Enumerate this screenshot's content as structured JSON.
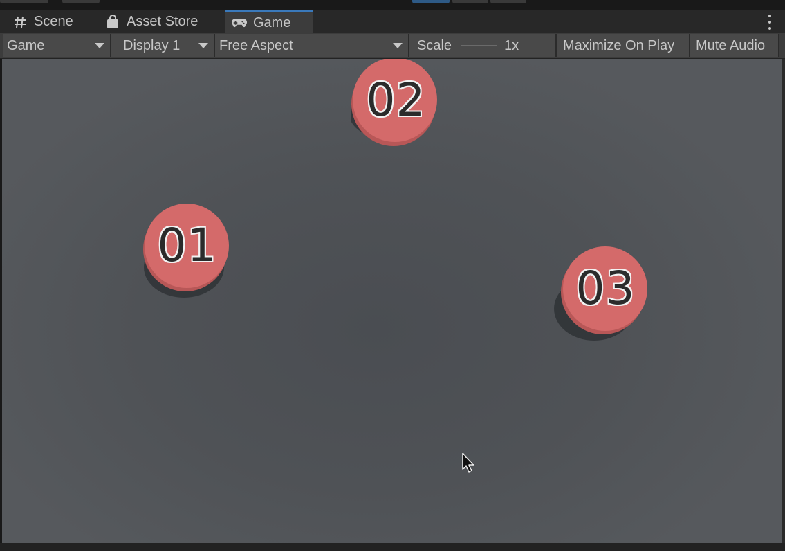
{
  "tabs": [
    {
      "label": "Scene",
      "icon": "grid-icon",
      "active": false
    },
    {
      "label": "Asset Store",
      "icon": "bag-icon",
      "active": false
    },
    {
      "label": "Game",
      "icon": "gamepad-icon",
      "active": true
    }
  ],
  "toolbar": {
    "view_mode": "Game",
    "display": "Display 1",
    "aspect": "Free Aspect",
    "scale_label": "Scale",
    "scale_value": "1x",
    "maximize_label": "Maximize On Play",
    "mute_label": "Mute Audio"
  },
  "game": {
    "tokens": [
      {
        "label": "01",
        "color": "#d46a6a"
      },
      {
        "label": "02",
        "color": "#d46a6a"
      },
      {
        "label": "03",
        "color": "#d46a6a"
      }
    ]
  },
  "colors": {
    "accent": "#3a79bb",
    "token_fill": "#d46a6a",
    "token_edge": "#b85757"
  }
}
